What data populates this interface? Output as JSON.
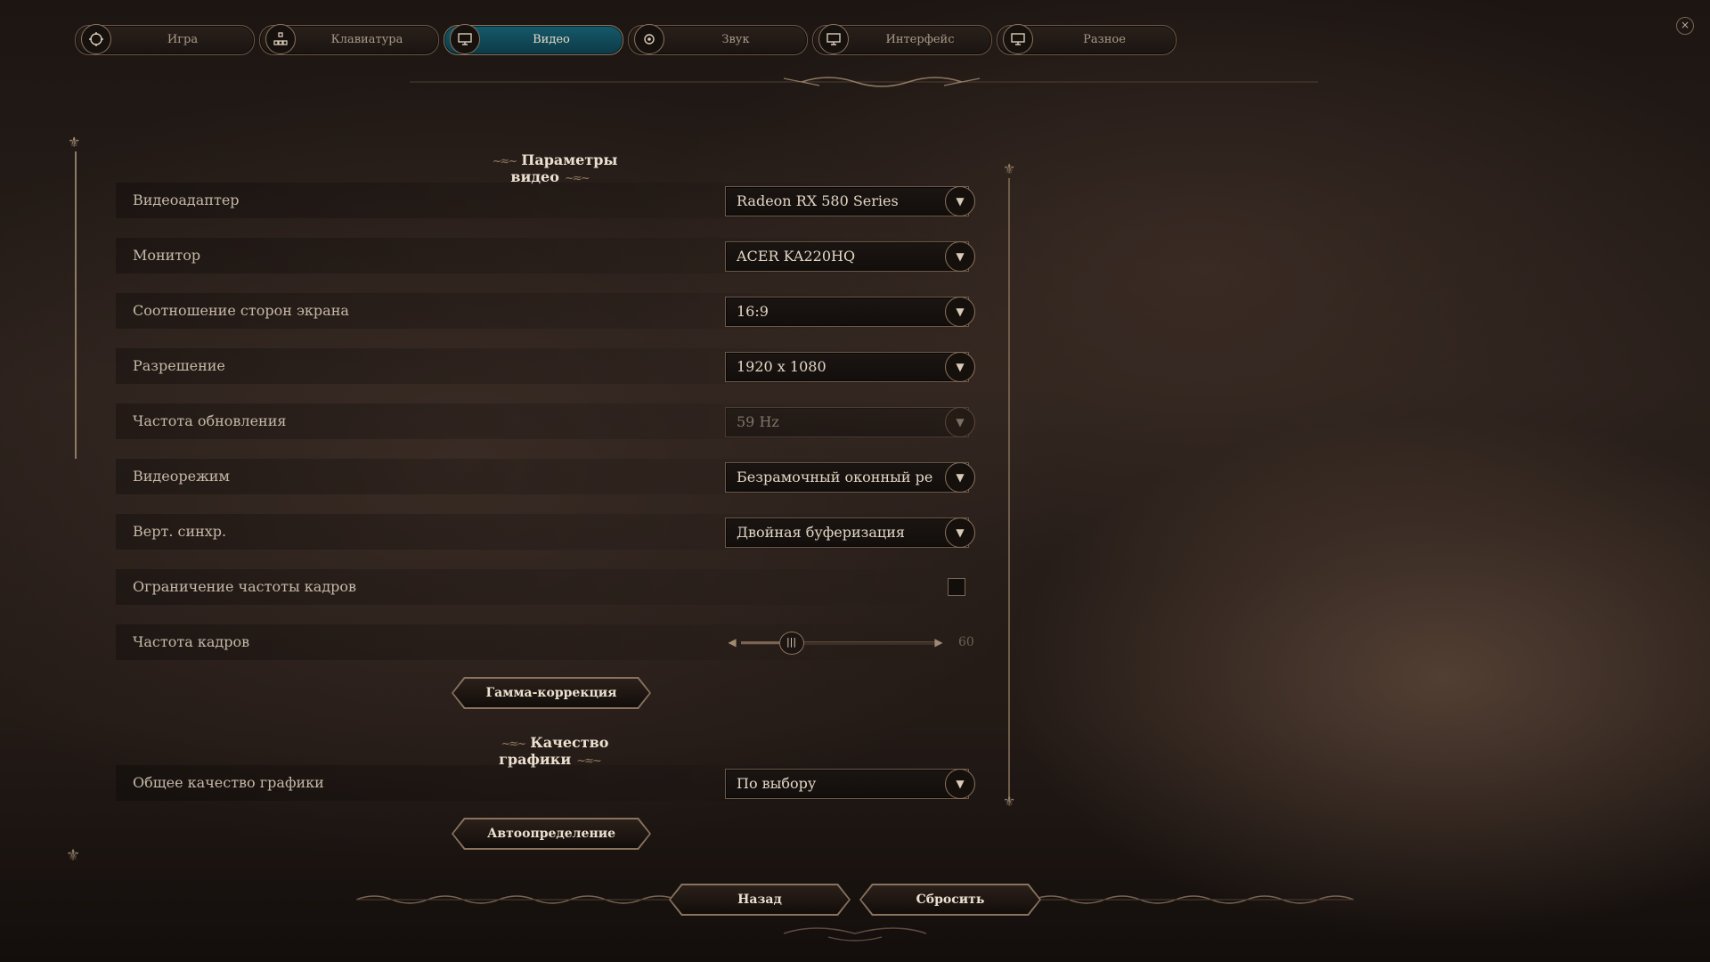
{
  "tabs": [
    {
      "label": "Игра",
      "icon": "game-settings-icon",
      "active": false
    },
    {
      "label": "Клавиатура",
      "icon": "keyboard-icon",
      "active": false
    },
    {
      "label": "Видео",
      "icon": "monitor-icon",
      "active": true
    },
    {
      "label": "Звук",
      "icon": "speaker-icon",
      "active": false
    },
    {
      "label": "Интерфейс",
      "icon": "interface-icon",
      "active": false
    },
    {
      "label": "Разное",
      "icon": "misc-icon",
      "active": false
    }
  ],
  "close_glyph": "×",
  "sections": {
    "video": "Параметры видео",
    "quality": "Качество графики"
  },
  "settings": {
    "adapter": {
      "label": "Видеоадаптер",
      "value": "Radeon RX 580 Series"
    },
    "monitor": {
      "label": "Монитор",
      "value": "ACER KA220HQ"
    },
    "aspect": {
      "label": "Соотношение сторон экрана",
      "value": "16:9"
    },
    "resolution": {
      "label": "Разрешение",
      "value": "1920 x 1080"
    },
    "refresh": {
      "label": "Частота обновления",
      "value": "59 Hz",
      "disabled": true
    },
    "mode": {
      "label": "Видеорежим",
      "value": "Безрамочный оконный режим"
    },
    "vsync": {
      "label": "Верт. синхр.",
      "value": "Двойная буферизация"
    },
    "fps_limit": {
      "label": "Ограничение частоты кадров",
      "checked": false
    },
    "fps": {
      "label": "Частота кадров",
      "value": "60",
      "level": 0.25
    },
    "overall_quality": {
      "label": "Общее качество графики",
      "value": "По выбору"
    }
  },
  "buttons": {
    "gamma": "Гамма-коррекция",
    "autodetect": "Автоопределение",
    "back": "Назад",
    "reset": "Сбросить"
  },
  "colors": {
    "accent_active_tab": "#155a6a",
    "border_gold": "#8a735e",
    "text": "#cbbfae"
  }
}
